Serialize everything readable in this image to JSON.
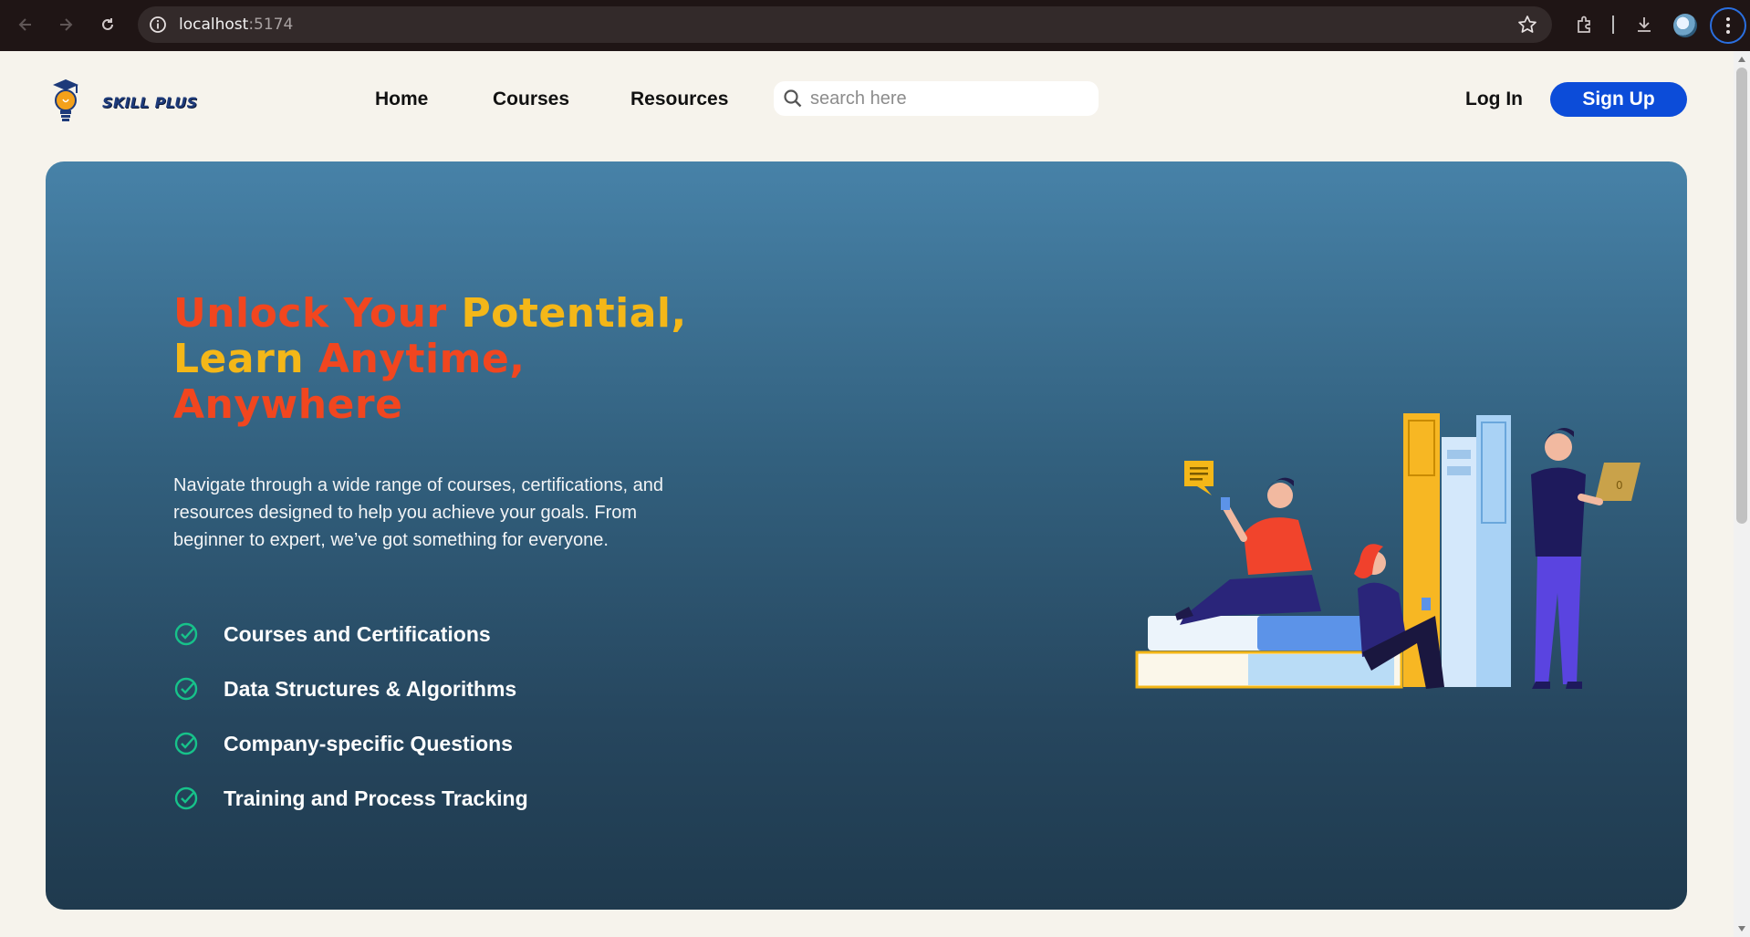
{
  "browser": {
    "url_host": "localhost",
    "url_port": ":5174"
  },
  "header": {
    "brand": "SKILL PLUS",
    "nav": [
      "Home",
      "Courses",
      "Resources"
    ],
    "search_placeholder": "search here",
    "login": "Log In",
    "signup": "Sign Up"
  },
  "hero": {
    "headline": {
      "w1": "Unlock Your",
      "w2": "Potential,",
      "w3": "Learn",
      "w4": "Anytime,",
      "w5": "Anywhere"
    },
    "intro": "Navigate through a wide range of courses, certifications, and resources designed to help you achieve your goals. From beginner to expert, we’ve got something for everyone.",
    "features": [
      "Courses and Certifications",
      "Data Structures & Algorithms",
      "Company-specific Questions",
      "Training and Process Tracking"
    ],
    "laptop_badge": "0"
  },
  "colors": {
    "accent_orange": "#f1461f",
    "accent_yellow": "#f4b718",
    "primary_blue": "#0c4cd9",
    "check_green": "#17c28a"
  }
}
